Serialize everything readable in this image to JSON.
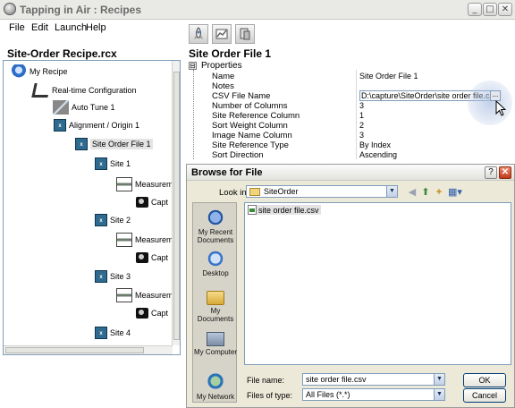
{
  "window": {
    "title": "Tapping in Air : Recipes",
    "controls": {
      "minimize": "_",
      "maximize": "□",
      "close": "✕"
    }
  },
  "menu": [
    "File",
    "Edit",
    "Launch",
    "Help"
  ],
  "toolbar": [
    {
      "icon": "rocket-icon"
    },
    {
      "icon": "chart-icon"
    },
    {
      "icon": "tools-icon"
    }
  ],
  "left_title": "Site-Order Recipe.rcx",
  "right_title": "Site Order File 1",
  "tree": [
    {
      "label": "My Recipe",
      "icon": "robot-icon"
    },
    {
      "label": "Real-time Configuration",
      "icon": "microscope-icon"
    },
    {
      "label": "Auto Tune 1",
      "icon": "tune-icon"
    },
    {
      "label": "Alignment / Origin 1",
      "icon": "alignment-icon"
    },
    {
      "label": "Site Order File 1",
      "icon": "site-order-icon"
    },
    {
      "label": "Site 1",
      "icon": "site-icon"
    },
    {
      "label": "Measuremer",
      "icon": "measurement-icon"
    },
    {
      "label": "Capt",
      "icon": "camera-icon"
    },
    {
      "label": "Site 2",
      "icon": "site-icon"
    },
    {
      "label": "Measuremer",
      "icon": "measurement-icon"
    },
    {
      "label": "Capt",
      "icon": "camera-icon"
    },
    {
      "label": "Site 3",
      "icon": "site-icon"
    },
    {
      "label": "Measuremer",
      "icon": "measurement-icon"
    },
    {
      "label": "Capt",
      "icon": "camera-icon"
    },
    {
      "label": "Site 4",
      "icon": "site-icon"
    }
  ],
  "properties": {
    "header": "Properties",
    "expander": "⊟",
    "rows": [
      {
        "name": "Name",
        "value": "Site Order File 1"
      },
      {
        "name": "Notes",
        "value": ""
      },
      {
        "name": "CSV File Name",
        "value": "D:\\capture\\SiteOrder\\site order file.csv"
      },
      {
        "name": "Number of Columns",
        "value": "3"
      },
      {
        "name": "Site Reference Column",
        "value": "1"
      },
      {
        "name": "Sort Weight Column",
        "value": "2"
      },
      {
        "name": "Image Name Column",
        "value": "3"
      },
      {
        "name": "Site Reference Type",
        "value": "By Index"
      },
      {
        "name": "Sort Direction",
        "value": "Ascending"
      }
    ],
    "ellipsis": "..."
  },
  "dialog": {
    "title": "Browse for File",
    "help": "?",
    "close": "✕",
    "look_in_label": "Look in:",
    "look_in_value": "SiteOrder",
    "places": [
      "My Recent Documents",
      "Desktop",
      "My Documents",
      "My Computer",
      "My Network"
    ],
    "files": [
      "site order file.csv"
    ],
    "file_name_label": "File name:",
    "file_name_value": "site order file.csv",
    "files_of_type_label": "Files of type:",
    "files_of_type_value": "All Files (*.*)",
    "ok": "OK",
    "cancel": "Cancel"
  }
}
